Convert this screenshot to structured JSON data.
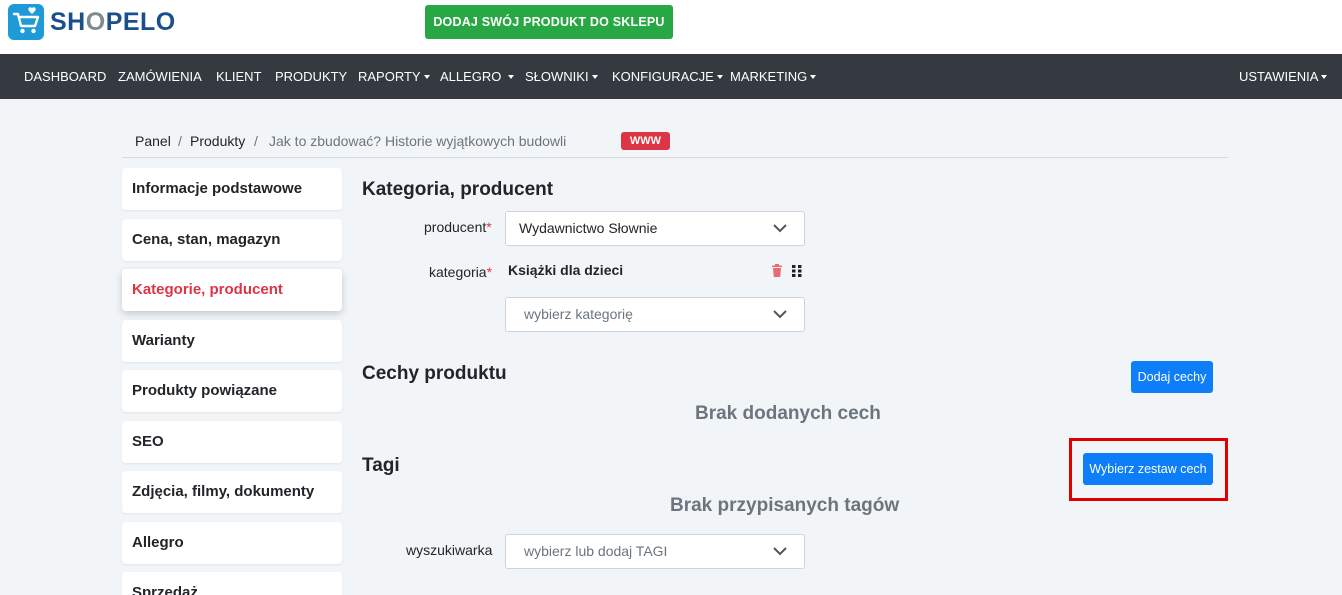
{
  "brand": {
    "name_part1": "SH",
    "name_o": "O",
    "name_part2": "PELO"
  },
  "header": {
    "add_product_label": "DODAJ SWÓJ PRODUKT DO SKLEPU"
  },
  "nav": {
    "dashboard": "DASHBOARD",
    "zamowienia": "ZAMÓWIENIA",
    "klient": "KLIENT",
    "produkty": "PRODUKTY",
    "raporty": "RAPORTY",
    "allegro": "ALLEGRO",
    "slowniki": "SŁOWNIKI",
    "konfiguracje": "KONFIGURACJE",
    "marketing": "MARKETING",
    "ustawienia": "USTAWIENIA"
  },
  "breadcrumb": {
    "panel": "Panel",
    "produkty": "Produkty",
    "current": "Jak to zbudować? Historie wyjątkowych budowli",
    "separator": "/",
    "badge": "WWW"
  },
  "sidebar": {
    "items": [
      {
        "label": "Informacje podstawowe"
      },
      {
        "label": "Cena, stan, magazyn"
      },
      {
        "label": "Kategorie, producent"
      },
      {
        "label": "Warianty"
      },
      {
        "label": "Produkty powiązane"
      },
      {
        "label": "SEO"
      },
      {
        "label": "Zdjęcia, filmy, dokumenty"
      },
      {
        "label": "Allegro"
      },
      {
        "label": "Sprzedaż"
      }
    ],
    "active_index": 2
  },
  "kategoria_section": {
    "title": "Kategoria, producent",
    "producent_label": "producent",
    "producent_value": "Wydawnictwo Słownie",
    "kategoria_label": "kategoria",
    "kategoria_value": "Książki dla dzieci",
    "kategoria_placeholder": "wybierz kategorię",
    "required_mark": "*"
  },
  "cechy_section": {
    "title": "Cechy produktu",
    "add_button": "Dodaj cechy",
    "empty_text": "Brak dodanych cech"
  },
  "tagi_section": {
    "title": "Tagi",
    "set_button": "Wybierz zestaw cech",
    "empty_text": "Brak przypisanych tagów",
    "search_label": "wyszukiwarka",
    "search_placeholder": "wybierz lub dodaj TAGI"
  },
  "colors": {
    "navbar": "#343a40",
    "success": "#28a745",
    "primary": "#0d7ef7",
    "danger": "#dc3545",
    "highlight": "#e00000"
  },
  "icons": [
    "cart-logo-icon",
    "chevron-down-icon",
    "trash-icon",
    "drag-grip-icon",
    "caret-down-icon"
  ]
}
